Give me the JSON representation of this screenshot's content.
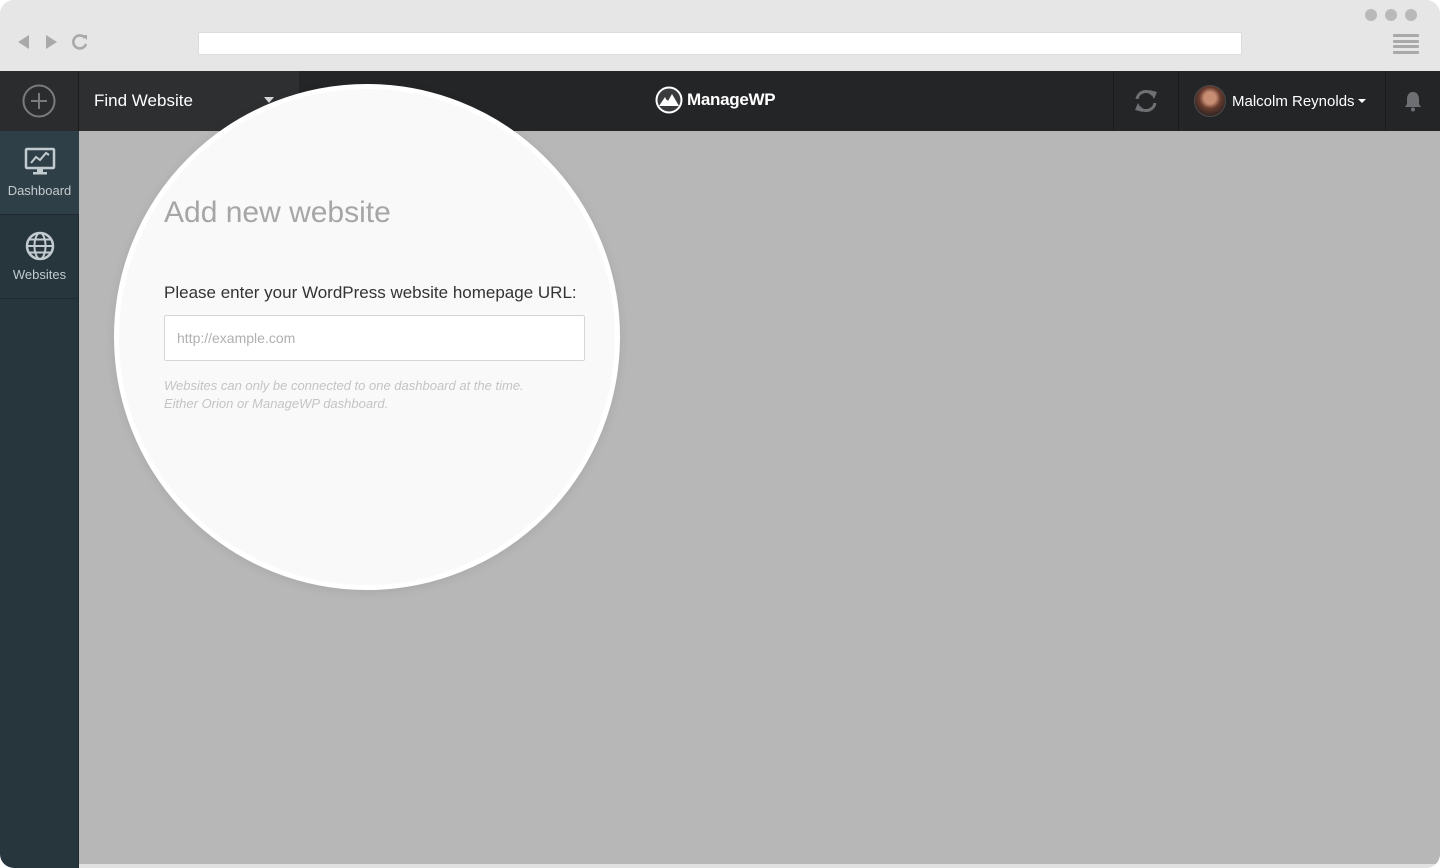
{
  "app": {
    "brand_name": "ManageWP",
    "brand_color": "#242527",
    "sidebar_color": "#27353d"
  },
  "header": {
    "find_website_label": "Find Website",
    "user_name": "Malcolm Reynolds"
  },
  "sidebar": {
    "items": [
      {
        "label": "Dashboard",
        "icon": "dashboard-monitor-icon",
        "active": true
      },
      {
        "label": "Websites",
        "icon": "globe-icon",
        "active": false
      }
    ]
  },
  "add_website": {
    "title": "Add new website",
    "url_label": "Please enter your WordPress website homepage URL:",
    "url_placeholder": "http://example.com",
    "url_value": "",
    "help_line1": "Websites can only be connected to one dashboard at the time.",
    "help_line2": "Either Orion or ManageWP dashboard."
  },
  "icons": {
    "add": "plus-circle-icon",
    "dropdown": "caret-down-icon",
    "sync": "refresh-icon",
    "notifications": "bell-icon"
  }
}
